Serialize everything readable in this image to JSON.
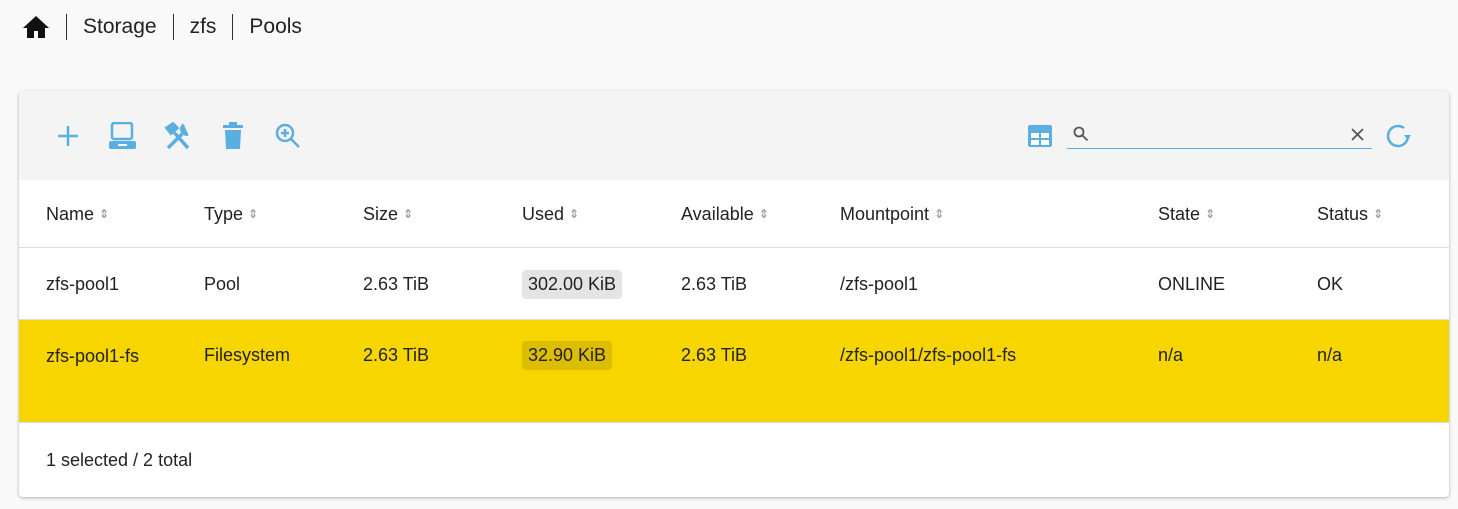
{
  "breadcrumb": [
    "Storage",
    "zfs",
    "Pools"
  ],
  "search": {
    "value": "",
    "placeholder": ""
  },
  "columns": [
    "Name",
    "Type",
    "Size",
    "Used",
    "Available",
    "Mountpoint",
    "State",
    "Status"
  ],
  "rows": [
    [
      "zfs-pool1",
      "Pool",
      "2.63 TiB",
      "302.00 KiB",
      "2.63 TiB",
      "/zfs-pool1",
      "ONLINE",
      "OK"
    ],
    [
      "zfs-pool1-fs",
      "Filesystem",
      "2.63 TiB",
      "32.90 KiB",
      "2.63 TiB",
      "/zfs-pool1/zfs-pool1-fs",
      "n/a",
      "n/a"
    ]
  ],
  "footer": "1 selected / 2 total",
  "colors": {
    "accent": "#5aaee0",
    "selected": "#f7d500"
  }
}
